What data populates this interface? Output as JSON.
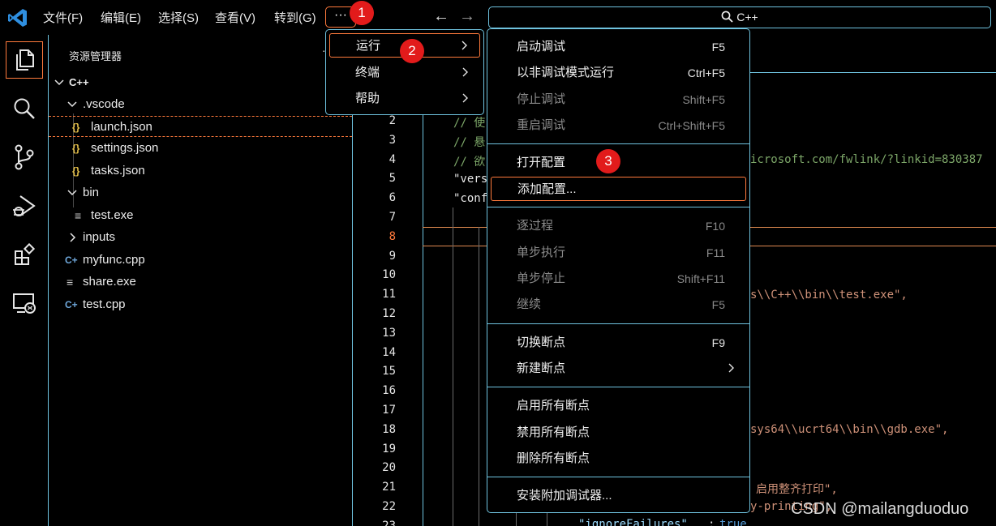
{
  "menubar": {
    "items": [
      "文件(F)",
      "编辑(E)",
      "选择(S)",
      "查看(V)",
      "转到(G)"
    ],
    "more": "···",
    "command_center": "C++"
  },
  "badges": [
    "1",
    "2",
    "3"
  ],
  "more_menu": {
    "items": [
      {
        "label": "运行",
        "submenu": true
      },
      {
        "label": "终端",
        "submenu": true
      },
      {
        "label": "帮助",
        "submenu": true
      }
    ]
  },
  "run_menu": {
    "items": [
      {
        "label": "启动调试",
        "key": "F5",
        "disabled": false
      },
      {
        "label": "以非调试模式运行",
        "key": "Ctrl+F5",
        "disabled": false
      },
      {
        "label": "停止调试",
        "key": "Shift+F5",
        "disabled": true
      },
      {
        "label": "重启调试",
        "key": "Ctrl+Shift+F5",
        "disabled": true
      },
      {
        "label": "打开配置",
        "key": "",
        "disabled": false
      },
      {
        "label": "添加配置...",
        "key": "",
        "disabled": false
      },
      {
        "label": "逐过程",
        "key": "F10",
        "disabled": true
      },
      {
        "label": "单步执行",
        "key": "F11",
        "disabled": true
      },
      {
        "label": "单步停止",
        "key": "Shift+F11",
        "disabled": true
      },
      {
        "label": "继续",
        "key": "F5",
        "disabled": true
      },
      {
        "label": "切换断点",
        "key": "F9",
        "disabled": false
      },
      {
        "label": "新建断点",
        "key": "",
        "disabled": false
      },
      {
        "label": "启用所有断点",
        "key": "",
        "disabled": false
      },
      {
        "label": "禁用所有断点",
        "key": "",
        "disabled": false
      },
      {
        "label": "删除所有断点",
        "key": "",
        "disabled": false
      },
      {
        "label": "安装附加调试器...",
        "key": "",
        "disabled": false
      }
    ]
  },
  "explorer": {
    "title": "资源管理器",
    "tree": [
      {
        "label": "C++",
        "type": "root"
      },
      {
        "label": ".vscode",
        "type": "folder"
      },
      {
        "label": "launch.json",
        "type": "json"
      },
      {
        "label": "settings.json",
        "type": "json"
      },
      {
        "label": "tasks.json",
        "type": "json"
      },
      {
        "label": "bin",
        "type": "folder"
      },
      {
        "label": "test.exe",
        "type": "exe"
      },
      {
        "label": "inputs",
        "type": "folder-closed"
      },
      {
        "label": "myfunc.cpp",
        "type": "cpp"
      },
      {
        "label": "share.exe",
        "type": "exe"
      },
      {
        "label": "test.cpp",
        "type": "cpp"
      }
    ]
  },
  "editor": {
    "line_numbers": [
      "2",
      "3",
      "4",
      "5",
      "6",
      "7",
      "8",
      "9",
      "10",
      "11",
      "12",
      "13",
      "14",
      "15",
      "16",
      "17",
      "18",
      "19",
      "20",
      "21",
      "22",
      "23"
    ],
    "current_line": "8",
    "fragments": {
      "l2": "// 使",
      "l3": "// 悬",
      "l4": "// 欲",
      "l4_tail": "icrosoft.com/fwlink/?linkid=830387",
      "l5": "\"vers",
      "l6": "\"conf",
      "l11_tail": "s\\\\C++\\\\bin\\\\test.exe\",",
      "l18_tail": "sys64\\\\ucrt64\\\\bin\\\\gdb.exe\",",
      "l21_tail": "启用整齐打印\",",
      "l22_tail": "y-printing\",",
      "l23_key": "\"ignoreFailures\"",
      "l23_val": "true"
    }
  },
  "watermark": "CSDN @mailangduoduo"
}
